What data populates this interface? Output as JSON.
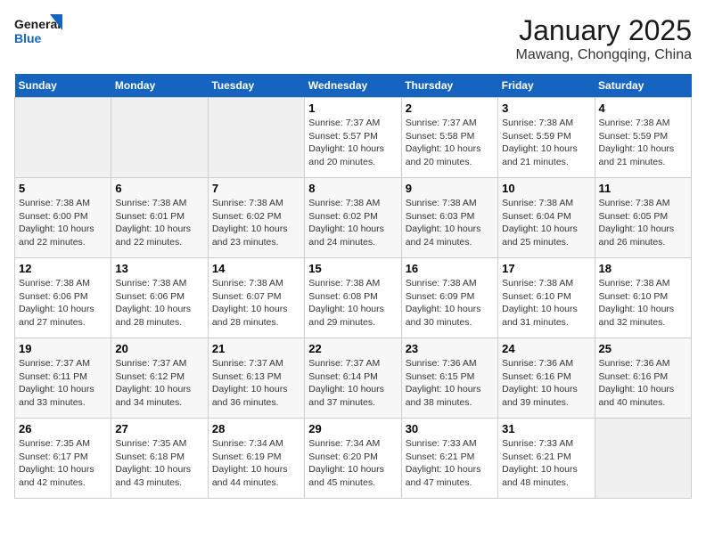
{
  "logo": {
    "line1": "General",
    "line2": "Blue"
  },
  "calendar": {
    "title": "January 2025",
    "subtitle": "Mawang, Chongqing, China"
  },
  "weekdays": [
    "Sunday",
    "Monday",
    "Tuesday",
    "Wednesday",
    "Thursday",
    "Friday",
    "Saturday"
  ],
  "weeks": [
    [
      {
        "day": "",
        "info": ""
      },
      {
        "day": "",
        "info": ""
      },
      {
        "day": "",
        "info": ""
      },
      {
        "day": "1",
        "info": "Sunrise: 7:37 AM\nSunset: 5:57 PM\nDaylight: 10 hours\nand 20 minutes."
      },
      {
        "day": "2",
        "info": "Sunrise: 7:37 AM\nSunset: 5:58 PM\nDaylight: 10 hours\nand 20 minutes."
      },
      {
        "day": "3",
        "info": "Sunrise: 7:38 AM\nSunset: 5:59 PM\nDaylight: 10 hours\nand 21 minutes."
      },
      {
        "day": "4",
        "info": "Sunrise: 7:38 AM\nSunset: 5:59 PM\nDaylight: 10 hours\nand 21 minutes."
      }
    ],
    [
      {
        "day": "5",
        "info": "Sunrise: 7:38 AM\nSunset: 6:00 PM\nDaylight: 10 hours\nand 22 minutes."
      },
      {
        "day": "6",
        "info": "Sunrise: 7:38 AM\nSunset: 6:01 PM\nDaylight: 10 hours\nand 22 minutes."
      },
      {
        "day": "7",
        "info": "Sunrise: 7:38 AM\nSunset: 6:02 PM\nDaylight: 10 hours\nand 23 minutes."
      },
      {
        "day": "8",
        "info": "Sunrise: 7:38 AM\nSunset: 6:02 PM\nDaylight: 10 hours\nand 24 minutes."
      },
      {
        "day": "9",
        "info": "Sunrise: 7:38 AM\nSunset: 6:03 PM\nDaylight: 10 hours\nand 24 minutes."
      },
      {
        "day": "10",
        "info": "Sunrise: 7:38 AM\nSunset: 6:04 PM\nDaylight: 10 hours\nand 25 minutes."
      },
      {
        "day": "11",
        "info": "Sunrise: 7:38 AM\nSunset: 6:05 PM\nDaylight: 10 hours\nand 26 minutes."
      }
    ],
    [
      {
        "day": "12",
        "info": "Sunrise: 7:38 AM\nSunset: 6:06 PM\nDaylight: 10 hours\nand 27 minutes."
      },
      {
        "day": "13",
        "info": "Sunrise: 7:38 AM\nSunset: 6:06 PM\nDaylight: 10 hours\nand 28 minutes."
      },
      {
        "day": "14",
        "info": "Sunrise: 7:38 AM\nSunset: 6:07 PM\nDaylight: 10 hours\nand 28 minutes."
      },
      {
        "day": "15",
        "info": "Sunrise: 7:38 AM\nSunset: 6:08 PM\nDaylight: 10 hours\nand 29 minutes."
      },
      {
        "day": "16",
        "info": "Sunrise: 7:38 AM\nSunset: 6:09 PM\nDaylight: 10 hours\nand 30 minutes."
      },
      {
        "day": "17",
        "info": "Sunrise: 7:38 AM\nSunset: 6:10 PM\nDaylight: 10 hours\nand 31 minutes."
      },
      {
        "day": "18",
        "info": "Sunrise: 7:38 AM\nSunset: 6:10 PM\nDaylight: 10 hours\nand 32 minutes."
      }
    ],
    [
      {
        "day": "19",
        "info": "Sunrise: 7:37 AM\nSunset: 6:11 PM\nDaylight: 10 hours\nand 33 minutes."
      },
      {
        "day": "20",
        "info": "Sunrise: 7:37 AM\nSunset: 6:12 PM\nDaylight: 10 hours\nand 34 minutes."
      },
      {
        "day": "21",
        "info": "Sunrise: 7:37 AM\nSunset: 6:13 PM\nDaylight: 10 hours\nand 36 minutes."
      },
      {
        "day": "22",
        "info": "Sunrise: 7:37 AM\nSunset: 6:14 PM\nDaylight: 10 hours\nand 37 minutes."
      },
      {
        "day": "23",
        "info": "Sunrise: 7:36 AM\nSunset: 6:15 PM\nDaylight: 10 hours\nand 38 minutes."
      },
      {
        "day": "24",
        "info": "Sunrise: 7:36 AM\nSunset: 6:16 PM\nDaylight: 10 hours\nand 39 minutes."
      },
      {
        "day": "25",
        "info": "Sunrise: 7:36 AM\nSunset: 6:16 PM\nDaylight: 10 hours\nand 40 minutes."
      }
    ],
    [
      {
        "day": "26",
        "info": "Sunrise: 7:35 AM\nSunset: 6:17 PM\nDaylight: 10 hours\nand 42 minutes."
      },
      {
        "day": "27",
        "info": "Sunrise: 7:35 AM\nSunset: 6:18 PM\nDaylight: 10 hours\nand 43 minutes."
      },
      {
        "day": "28",
        "info": "Sunrise: 7:34 AM\nSunset: 6:19 PM\nDaylight: 10 hours\nand 44 minutes."
      },
      {
        "day": "29",
        "info": "Sunrise: 7:34 AM\nSunset: 6:20 PM\nDaylight: 10 hours\nand 45 minutes."
      },
      {
        "day": "30",
        "info": "Sunrise: 7:33 AM\nSunset: 6:21 PM\nDaylight: 10 hours\nand 47 minutes."
      },
      {
        "day": "31",
        "info": "Sunrise: 7:33 AM\nSunset: 6:21 PM\nDaylight: 10 hours\nand 48 minutes."
      },
      {
        "day": "",
        "info": ""
      }
    ]
  ]
}
